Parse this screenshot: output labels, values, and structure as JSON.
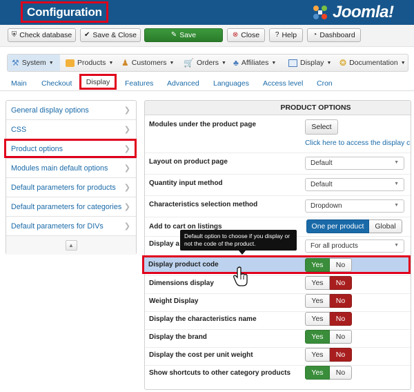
{
  "header": {
    "title": "Configuration",
    "logo_text": "Joomla!",
    "logo_icon": "joomla-logo-icon"
  },
  "toolbar": {
    "buttons": [
      {
        "label": "Check database",
        "icon": "shield-icon"
      },
      {
        "label": "Save & Close",
        "icon": "check-icon"
      },
      {
        "label": "Save",
        "icon": "save-icon"
      },
      {
        "label": "Close",
        "icon": "cancel-icon"
      },
      {
        "label": "Help",
        "icon": "question-icon"
      },
      {
        "label": "Dashboard",
        "icon": "dashboard-icon"
      }
    ]
  },
  "menu": {
    "items": [
      {
        "label": "System",
        "icon": "tools-icon"
      },
      {
        "label": "Products",
        "icon": "products-icon"
      },
      {
        "label": "Customers",
        "icon": "customers-icon"
      },
      {
        "label": "Orders",
        "icon": "cart-icon"
      },
      {
        "label": "Affiliates",
        "icon": "affiliates-icon"
      },
      {
        "label": "Display",
        "icon": "display-icon"
      },
      {
        "label": "Documentation",
        "icon": "docs-icon"
      }
    ]
  },
  "tabs": [
    "Main",
    "Checkout",
    "Display",
    "Features",
    "Advanced",
    "Languages",
    "Access level",
    "Cron"
  ],
  "sidebar": {
    "items": [
      "General display options",
      "CSS",
      "Product options",
      "Modules main default options",
      "Default parameters for products",
      "Default parameters for categories",
      "Default parameters for DIVs"
    ],
    "footer_icon": "eject-icon"
  },
  "panel": {
    "heading": "PRODUCT OPTIONS",
    "modules": {
      "label": "Modules under the product page",
      "button": "Select",
      "link": "Click here to access the display c"
    },
    "layout": {
      "label": "Layout on product page",
      "value": "Default"
    },
    "quantity": {
      "label": "Quantity input method",
      "value": "Default"
    },
    "characteristics": {
      "label": "Characteristics selection method",
      "value": "Dropdown"
    },
    "add_to_cart": {
      "label": "Add to cart on listings",
      "options": [
        "One per product",
        "Global"
      ],
      "selected": "One per product"
    },
    "display_row": {
      "label": "Display a",
      "value": "For all products"
    },
    "toggles": [
      {
        "label": "Display product code",
        "selected": "Yes"
      },
      {
        "label": "Dimensions display",
        "selected": "No"
      },
      {
        "label": "Weight Display",
        "selected": "No"
      },
      {
        "label": "Display the characteristics name",
        "selected": "No"
      },
      {
        "label": "Display the brand",
        "selected": "Yes"
      },
      {
        "label": "Display the cost per unit weight",
        "selected": "No"
      },
      {
        "label": "Show shortcuts to other category products",
        "selected": "Yes"
      }
    ],
    "yes_label": "Yes",
    "no_label": "No"
  },
  "tooltip": {
    "line1": "Default option to choose if you display or",
    "line2": "not the code of the product."
  },
  "colors": {
    "header": "#17568c",
    "highlight": "#e0001b",
    "yes_active": "#3a8d3a",
    "no_active": "#a81e1e",
    "link": "#1a6aa8"
  }
}
